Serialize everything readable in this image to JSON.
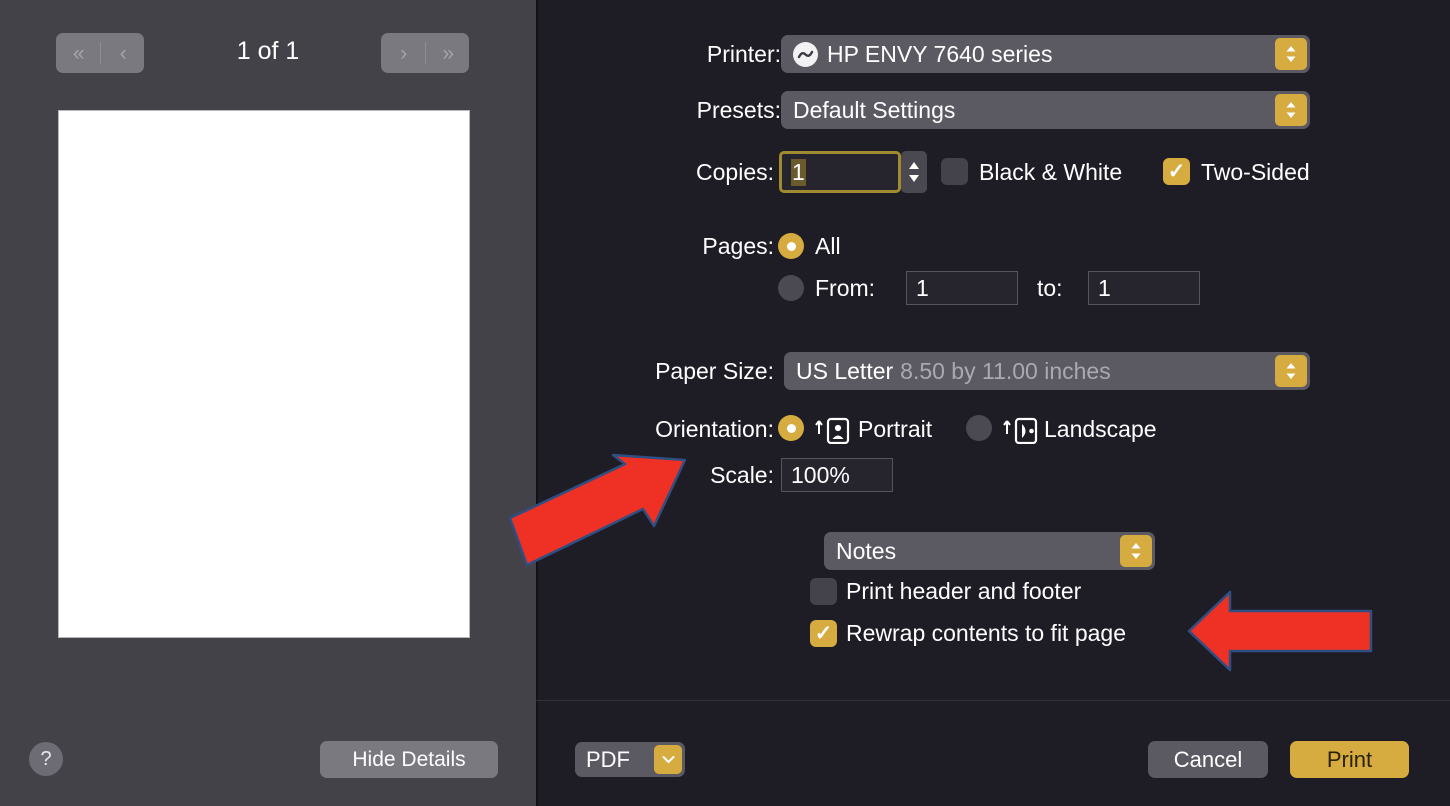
{
  "preview": {
    "page_count_label": "1 of 1",
    "nav": {
      "first_icon": "chevron-double-left-icon",
      "prev_icon": "chevron-left-icon",
      "next_icon": "chevron-right-icon",
      "last_icon": "chevron-double-right-icon"
    },
    "help_label": "?",
    "hide_details_label": "Hide Details"
  },
  "options": {
    "printer": {
      "label": "Printer:",
      "value": "HP ENVY 7640 series",
      "status_icon": "printer-status-icon"
    },
    "presets": {
      "label": "Presets:",
      "value": "Default Settings"
    },
    "copies": {
      "label": "Copies:",
      "value": "1",
      "stepper_up": "▲",
      "stepper_down": "▼",
      "black_white_label": "Black & White",
      "black_white_checked": false,
      "two_sided_label": "Two-Sided",
      "two_sided_checked": true
    },
    "pages": {
      "label": "Pages:",
      "all_label": "All",
      "all_selected": true,
      "from_label": "From:",
      "from_value": "1",
      "to_label": "to:",
      "to_value": "1",
      "range_selected": false
    },
    "paper_size": {
      "label": "Paper Size:",
      "value": "US Letter",
      "dimensions": "8.50 by 11.00 inches"
    },
    "orientation": {
      "label": "Orientation:",
      "portrait_label": "Portrait",
      "portrait_selected": true,
      "portrait_icon": "page-portrait-icon",
      "landscape_label": "Landscape",
      "landscape_selected": false,
      "landscape_icon": "page-landscape-icon"
    },
    "scale": {
      "label": "Scale:",
      "value": "100%"
    },
    "app_options": {
      "selected": "Notes",
      "print_header_footer_label": "Print header and footer",
      "print_header_footer_checked": false,
      "rewrap_label": "Rewrap contents to fit page",
      "rewrap_checked": true,
      "check_mark": "✓"
    }
  },
  "actions": {
    "pdf_label": "PDF",
    "pdf_chevron": "⌄",
    "cancel_label": "Cancel",
    "print_label": "Print"
  },
  "annotations": {
    "arrow_to_scale": "red-arrow-pointing-to-scale",
    "arrow_to_rewrap": "red-arrow-pointing-to-rewrap-checkbox",
    "arrow_fill": "#ee3124",
    "arrow_stroke": "#2f4f82"
  },
  "colors": {
    "accent": "#d6ab3f",
    "left_panel_bg": "#434248",
    "right_panel_bg": "#1e1d26"
  }
}
